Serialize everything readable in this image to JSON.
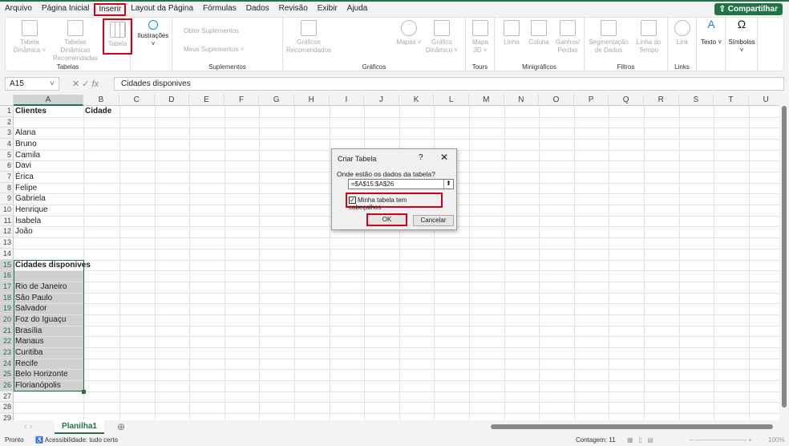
{
  "menu": [
    "Arquivo",
    "Página Inicial",
    "Inserir",
    "Layout da Página",
    "Fórmulas",
    "Dados",
    "Revisão",
    "Exibir",
    "Ajuda"
  ],
  "share": "Compartilhar",
  "ribbon": {
    "tabela_dinamica": "Tabela Dinâmica ˅",
    "tabelas_recomendadas": "Tabelas Dinâmicas Recomendadas",
    "tabela": "Tabela",
    "tabelas_group": "Tabelas",
    "ilustracoes": "Ilustrações ˅",
    "obter": "Obter Suplementos",
    "meus": "Meus Suplementos ˅",
    "suplementos_group": "Suplementos",
    "graficos_rec": "Gráficos Recomendados",
    "mapas": "Mapas ˅",
    "grafico_dinamico": "Gráfico Dinâmico ˅",
    "graficos_group": "Gráficos",
    "mapa3d": "Mapa 3D ˅",
    "tours_group": "Tours",
    "linha": "Linha",
    "coluna": "Coluna",
    "ganhos": "Ganhos/ Perdas",
    "mini_group": "Minigráficos",
    "segmentacao": "Segmentação de Dados",
    "linha_tempo": "Linha do Tempo",
    "filtros_group": "Filtros",
    "link": "Link",
    "links_group": "Links",
    "texto": "Texto ˅",
    "simbolos": "Símbolos ˅"
  },
  "formula_bar": {
    "name_box": "A15",
    "fx": "fx",
    "value": "Cidades disponives"
  },
  "columns": [
    "A",
    "B",
    "C",
    "D",
    "E",
    "F",
    "G",
    "H",
    "I",
    "J",
    "K",
    "L",
    "M",
    "N",
    "O",
    "P",
    "Q",
    "R",
    "S",
    "T",
    "U"
  ],
  "cells": {
    "1": {
      "A": "Clientes",
      "B": "Cidade"
    },
    "3": {
      "A": "Alana"
    },
    "4": {
      "A": "Bruno"
    },
    "5": {
      "A": "Camila"
    },
    "6": {
      "A": "Davi"
    },
    "7": {
      "A": "Érica"
    },
    "8": {
      "A": "Felipe"
    },
    "9": {
      "A": "Gabriela"
    },
    "10": {
      "A": "Henrique"
    },
    "11": {
      "A": "Isabela"
    },
    "12": {
      "A": "João"
    },
    "15": {
      "A": "Cidades disponives"
    },
    "17": {
      "A": "Rio de Janeiro"
    },
    "18": {
      "A": "São Paulo"
    },
    "19": {
      "A": "Salvador"
    },
    "20": {
      "A": "Foz do Iguaçu"
    },
    "21": {
      "A": "Brasília"
    },
    "22": {
      "A": "Manaus"
    },
    "23": {
      "A": "Curitiba"
    },
    "24": {
      "A": "Recife"
    },
    "25": {
      "A": "Belo Horizonte"
    },
    "26": {
      "A": "Florianópolis"
    }
  },
  "dialog": {
    "title": "Criar Tabela",
    "help": "?",
    "close": "✕",
    "label": "Onde estão os dados da tabela?",
    "range": "=$A$15:$A$26",
    "checkbox": "Minha tabela tem cabeçalhos",
    "checked": true,
    "ok": "OK",
    "cancel": "Cancelar"
  },
  "sheet_tab": "Planilha1",
  "status": {
    "ready": "Pronto",
    "accessibility": "Acessibilidade: tudo certo",
    "count": "Contagem: 11",
    "zoom": "100%"
  }
}
